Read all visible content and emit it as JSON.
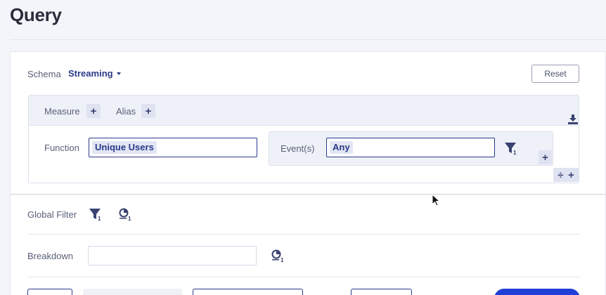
{
  "page": {
    "title": "Query"
  },
  "schema": {
    "label": "Schema",
    "value": "Streaming"
  },
  "reset": {
    "label": "Reset"
  },
  "measure_header": {
    "measure_label": "Measure",
    "alias_label": "Alias",
    "plus": "+"
  },
  "measure_row": {
    "function_label": "Function",
    "function_value": "Unique Users",
    "events_label": "Event(s)",
    "events_value": "Any",
    "filter_count": "1",
    "plus": "+",
    "divide": "÷"
  },
  "global_filter": {
    "label": "Global Filter",
    "filter_count": "1",
    "segment_count": "1"
  },
  "breakdown": {
    "label": "Breakdown",
    "value": "",
    "segment_count": "1"
  },
  "icons": [
    "download-icon",
    "filter-icon",
    "segment-icon",
    "plus-icon",
    "divide-icon"
  ],
  "colors": {
    "accent": "#2b3a8a",
    "primary": "#1f3fd6",
    "panel": "#eef1f8"
  }
}
